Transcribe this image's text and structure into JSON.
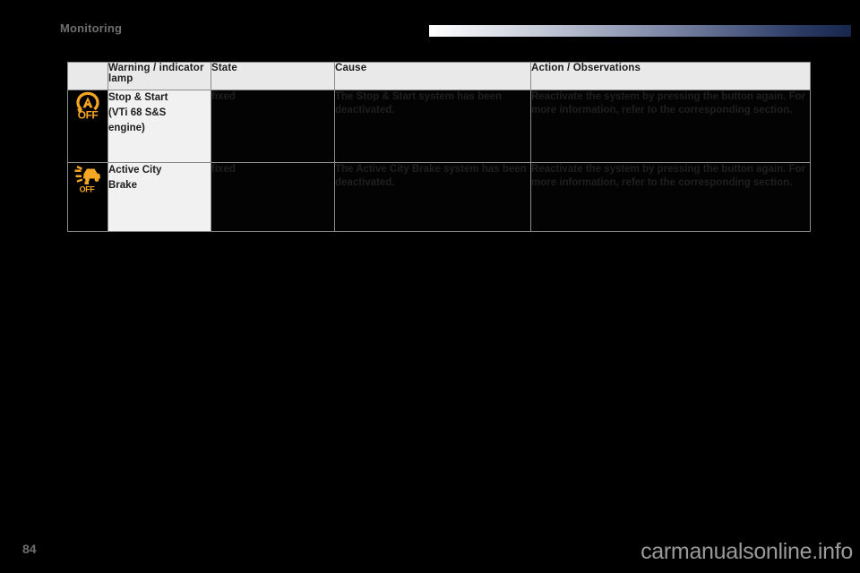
{
  "page": {
    "chapter_title": "Monitoring",
    "page_number": "84",
    "watermark": "carmanualsonline.info",
    "background_color": "#000000",
    "accent_gradient_from": "#ffffff",
    "accent_gradient_to": "#17264c",
    "icon_color": "#f5a623"
  },
  "table": {
    "headers": {
      "icon": "",
      "lamp": "Warning / indicator lamp",
      "state": "State",
      "cause": "Cause",
      "action": "Action / Observations"
    },
    "rows": [
      {
        "icon_name": "stop-and-start-off-icon",
        "lamp": "Stop & Start\n(VTi 68 S&S\nengine)",
        "lamp_line1": "Stop & Start",
        "lamp_line2": "(VTi 68 S&S",
        "lamp_line3": "engine)",
        "state": "fixed",
        "cause": "The Stop & Start system has been deactivated.",
        "action": "Reactivate the system by pressing the button again. For more information, refer to the corresponding section."
      },
      {
        "icon_name": "active-city-brake-off-icon",
        "lamp": "Active City\nBrake",
        "lamp_line1": "Active City",
        "lamp_line2": "Brake",
        "lamp_line3": "",
        "state": "fixed",
        "cause": "The Active City Brake system has been deactivated.",
        "action": "Reactivate the system by pressing the button again. For more information, refer to the corresponding section."
      }
    ]
  }
}
